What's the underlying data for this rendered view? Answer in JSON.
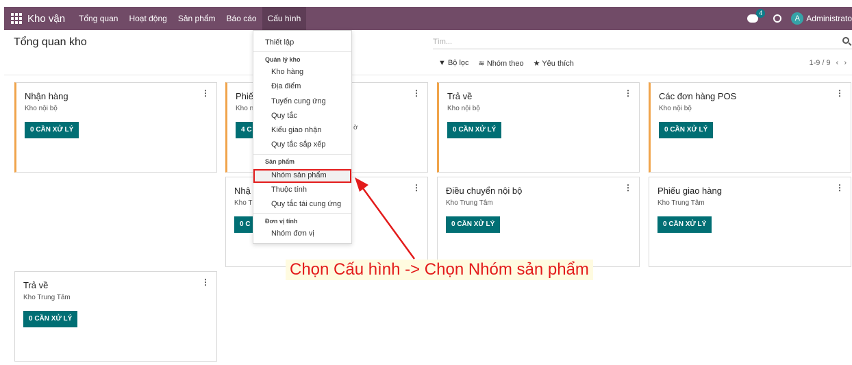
{
  "navbar": {
    "app_name": "Kho vận",
    "menu": [
      "Tổng quan",
      "Hoạt động",
      "Sản phẩm",
      "Báo cáo",
      "Cấu hình"
    ],
    "badge_count": "4",
    "avatar_letter": "A",
    "user_name": "Administrato",
    "color": "#714b67"
  },
  "control_panel": {
    "title": "Tổng quan kho",
    "search_placeholder": "Tìm...",
    "filter_label": "Bộ lọc",
    "group_label": "Nhóm theo",
    "favorite_label": "Yêu thích",
    "pager": "1-9 / 9"
  },
  "cards": [
    {
      "title": "Nhận hàng",
      "subtitle": "Kho nội bộ",
      "button": "0 CẦN XỬ LÝ"
    },
    {
      "title": "Phiế",
      "subtitle": "Kho n",
      "button": "4 C"
    },
    {
      "title": "Trả về",
      "subtitle": "Kho nội bộ",
      "button": "0 CẦN XỬ LÝ"
    },
    {
      "title": "Các đơn hàng POS",
      "subtitle": "Kho nội bộ",
      "button": "0 CẦN XỬ LÝ"
    },
    {
      "title": "Nhậ",
      "subtitle": "Kho T",
      "button": "0 C"
    },
    {
      "title": "Điều chuyển nội bộ",
      "subtitle": "Kho Trung Tâm",
      "button": "0 CẦN XỬ LÝ"
    },
    {
      "title": "Phiếu giao hàng",
      "subtitle": "Kho Trung Tâm",
      "button": "0 CẦN XỬ LÝ"
    },
    {
      "title": "Trả về",
      "subtitle": "Kho Trung Tâm",
      "button": "0 CẦN XỬ LÝ"
    }
  ],
  "dropdown": {
    "settings": "Thiết lập",
    "section_warehouse": "Quản lý kho",
    "warehouse_items": [
      "Kho hàng",
      "Địa điểm",
      "Tuyến cung ứng",
      "Quy tắc",
      "Kiểu giao nhận",
      "Quy tắc sắp xếp"
    ],
    "section_product": "Sản phẩm",
    "product_items": [
      "Nhóm sản phẩm",
      "Thuộc tính",
      "Quy tắc tái cung ứng"
    ],
    "section_uom": "Đơn vị tính",
    "uom_items": [
      "Nhóm đơn vị"
    ]
  },
  "annotation": {
    "text": "Chọn Cấu hình -> Chọn Nhóm sản phẩm",
    "color": "#e31b1b"
  },
  "partial_text": "ờ"
}
